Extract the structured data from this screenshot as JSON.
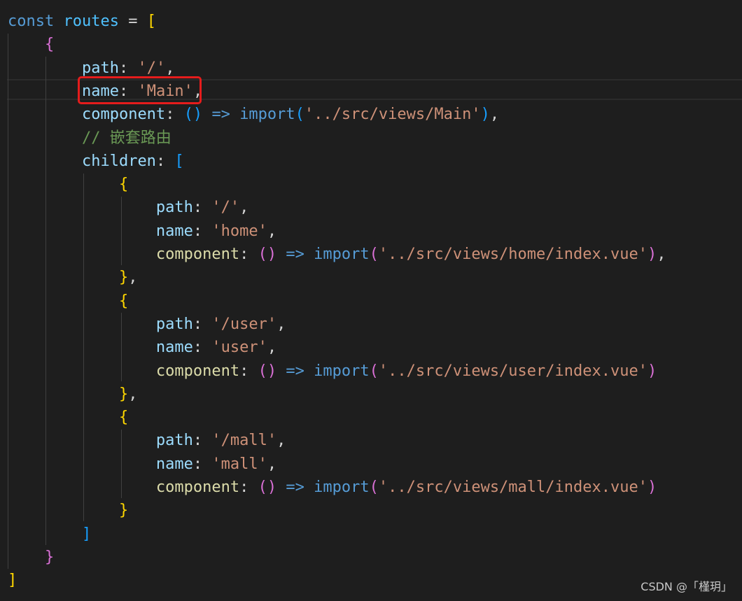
{
  "editor": {
    "lines": [
      [
        [
          "kw",
          "const"
        ],
        [
          "txt",
          " "
        ],
        [
          "var",
          "routes"
        ],
        [
          "txt",
          " = "
        ],
        [
          "b1",
          "["
        ]
      ],
      [
        [
          "txt",
          "    "
        ],
        [
          "b2",
          "{"
        ]
      ],
      [
        [
          "txt",
          "        "
        ],
        [
          "prop",
          "path"
        ],
        [
          "txt",
          ": "
        ],
        [
          "str",
          "'/'"
        ],
        [
          "txt",
          ","
        ]
      ],
      [
        [
          "txt",
          "        "
        ],
        [
          "prop",
          "name"
        ],
        [
          "txt",
          ": "
        ],
        [
          "str",
          "'Main'"
        ],
        [
          "txt",
          ","
        ]
      ],
      [
        [
          "txt",
          "        "
        ],
        [
          "prop",
          "component"
        ],
        [
          "txt",
          ": "
        ],
        [
          "b3",
          "()"
        ],
        [
          "txt",
          " "
        ],
        [
          "kw",
          "=>"
        ],
        [
          "txt",
          " "
        ],
        [
          "kw",
          "import"
        ],
        [
          "b3",
          "("
        ],
        [
          "str",
          "'../src/views/Main'"
        ],
        [
          "b3",
          ")"
        ],
        [
          "txt",
          ","
        ]
      ],
      [
        [
          "txt",
          "        "
        ],
        [
          "cmt",
          "// 嵌套路由"
        ]
      ],
      [
        [
          "txt",
          "        "
        ],
        [
          "prop",
          "children"
        ],
        [
          "txt",
          ": "
        ],
        [
          "b3",
          "["
        ]
      ],
      [
        [
          "txt",
          "            "
        ],
        [
          "b1",
          "{"
        ]
      ],
      [
        [
          "txt",
          "                "
        ],
        [
          "prop",
          "path"
        ],
        [
          "txt",
          ": "
        ],
        [
          "str",
          "'/'"
        ],
        [
          "txt",
          ","
        ]
      ],
      [
        [
          "txt",
          "                "
        ],
        [
          "prop",
          "name"
        ],
        [
          "txt",
          ": "
        ],
        [
          "str",
          "'home'"
        ],
        [
          "txt",
          ","
        ]
      ],
      [
        [
          "txt",
          "                "
        ],
        [
          "fn",
          "component"
        ],
        [
          "txt",
          ": "
        ],
        [
          "b2",
          "()"
        ],
        [
          "txt",
          " "
        ],
        [
          "kw",
          "=>"
        ],
        [
          "txt",
          " "
        ],
        [
          "kw",
          "import"
        ],
        [
          "b2",
          "("
        ],
        [
          "str",
          "'../src/views/home/index.vue'"
        ],
        [
          "b2",
          ")"
        ],
        [
          "txt",
          ","
        ]
      ],
      [
        [
          "txt",
          "            "
        ],
        [
          "b1",
          "}"
        ],
        [
          "txt",
          ","
        ]
      ],
      [
        [
          "txt",
          "            "
        ],
        [
          "b1",
          "{"
        ]
      ],
      [
        [
          "txt",
          "                "
        ],
        [
          "prop",
          "path"
        ],
        [
          "txt",
          ": "
        ],
        [
          "str",
          "'/user'"
        ],
        [
          "txt",
          ","
        ]
      ],
      [
        [
          "txt",
          "                "
        ],
        [
          "prop",
          "name"
        ],
        [
          "txt",
          ": "
        ],
        [
          "str",
          "'user'"
        ],
        [
          "txt",
          ","
        ]
      ],
      [
        [
          "txt",
          "                "
        ],
        [
          "fn",
          "component"
        ],
        [
          "txt",
          ": "
        ],
        [
          "b2",
          "()"
        ],
        [
          "txt",
          " "
        ],
        [
          "kw",
          "=>"
        ],
        [
          "txt",
          " "
        ],
        [
          "kw",
          "import"
        ],
        [
          "b2",
          "("
        ],
        [
          "str",
          "'../src/views/user/index.vue'"
        ],
        [
          "b2",
          ")"
        ]
      ],
      [
        [
          "txt",
          "            "
        ],
        [
          "b1",
          "}"
        ],
        [
          "txt",
          ","
        ]
      ],
      [
        [
          "txt",
          "            "
        ],
        [
          "b1",
          "{"
        ]
      ],
      [
        [
          "txt",
          "                "
        ],
        [
          "prop",
          "path"
        ],
        [
          "txt",
          ": "
        ],
        [
          "str",
          "'/mall'"
        ],
        [
          "txt",
          ","
        ]
      ],
      [
        [
          "txt",
          "                "
        ],
        [
          "prop",
          "name"
        ],
        [
          "txt",
          ": "
        ],
        [
          "str",
          "'mall'"
        ],
        [
          "txt",
          ","
        ]
      ],
      [
        [
          "txt",
          "                "
        ],
        [
          "fn",
          "component"
        ],
        [
          "txt",
          ": "
        ],
        [
          "b2",
          "()"
        ],
        [
          "txt",
          " "
        ],
        [
          "kw",
          "=>"
        ],
        [
          "txt",
          " "
        ],
        [
          "kw",
          "import"
        ],
        [
          "b2",
          "("
        ],
        [
          "str",
          "'../src/views/mall/index.vue'"
        ],
        [
          "b2",
          ")"
        ]
      ],
      [
        [
          "txt",
          "            "
        ],
        [
          "b1",
          "}"
        ]
      ],
      [
        [
          "txt",
          "        "
        ],
        [
          "b3",
          "]"
        ]
      ],
      [
        [
          "txt",
          "    "
        ],
        [
          "b2",
          "}"
        ]
      ],
      [
        [
          "b1",
          "]"
        ]
      ]
    ],
    "colors": {
      "background": "#1e1e1e",
      "kw": "#569cd6",
      "var": "#4fc1ff",
      "prop": "#9cdcfe",
      "fn": "#dcdcaa",
      "str": "#ce9178",
      "cmt": "#6a9955",
      "txt": "#d4d4d4",
      "b1": "#ffd700",
      "b2": "#da70d6",
      "b3": "#179fff",
      "highlight": "#e51c1c"
    }
  },
  "watermark": "CSDN @「槿玥」"
}
